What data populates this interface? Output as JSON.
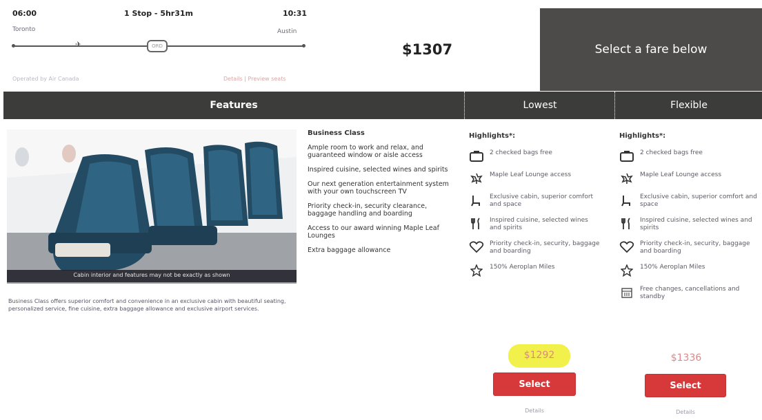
{
  "itinerary": {
    "depart_time": "06:00",
    "stop_info": "1 Stop - 5hr31m",
    "arrive_time": "10:31",
    "origin": "Toronto",
    "destination": "Austin",
    "stop_code": "ORD",
    "sub_note": "Operated by Air Canada",
    "details_link": "Details | Preview seats"
  },
  "price": "$1307",
  "select_fare_header": "Select a fare below",
  "columns": {
    "features": "Features",
    "lowest": "Lowest",
    "flexible": "Flexible"
  },
  "image": {
    "caption": "Cabin interior and features may not be exactly as shown"
  },
  "description": "Business Class offers superior comfort and convenience in an exclusive cabin with beautiful seating, personalized service, fine cuisine, extra baggage allowance and exclusive airport services.",
  "business_class": {
    "title": "Business Class",
    "items": [
      "Ample room to work and relax, and guaranteed window or aisle access",
      "Inspired cuisine, selected wines and spirits",
      "Our next generation entertainment system with your own touchscreen TV",
      "Priority check-in, security clearance, baggage handling and boarding",
      "Access to our award winning Maple Leaf Lounges",
      "Extra baggage allowance"
    ]
  },
  "lowest": {
    "title": "Highlights*:",
    "items": [
      {
        "icon": "suitcase-icon",
        "text": "2 checked bags free"
      },
      {
        "icon": "maple-leaf-icon",
        "text": "Maple Leaf Lounge access"
      },
      {
        "icon": "seat-icon",
        "text": "Exclusive cabin, superior comfort and space"
      },
      {
        "icon": "cutlery-icon",
        "text": "Inspired cuisine, selected wines and spirits"
      },
      {
        "icon": "heart-icon",
        "text": "Priority check-in, security, baggage and boarding"
      },
      {
        "icon": "star-icon",
        "text": "150% Aeroplan Miles"
      }
    ],
    "price": "$1292",
    "select_label": "Select",
    "details_label": "Details"
  },
  "flexible": {
    "title": "Highlights*:",
    "items": [
      {
        "icon": "suitcase-icon",
        "text": "2 checked bags free"
      },
      {
        "icon": "maple-leaf-icon",
        "text": "Maple Leaf Lounge access"
      },
      {
        "icon": "seat-icon",
        "text": "Exclusive cabin, superior comfort and space"
      },
      {
        "icon": "cutlery-icon",
        "text": "Inspired cuisine, selected wines and spirits"
      },
      {
        "icon": "heart-icon",
        "text": "Priority check-in, security, baggage and boarding"
      },
      {
        "icon": "star-icon",
        "text": "150% Aeroplan Miles"
      },
      {
        "icon": "calendar-icon",
        "text": "Free changes, cancellations and standby"
      }
    ],
    "price": "$1336",
    "select_label": "Select",
    "details_label": "Details"
  },
  "colors": {
    "header_dark": "#3c3d3a",
    "select_red": "#d7383a",
    "highlight_yellow": "#f2f04a"
  }
}
